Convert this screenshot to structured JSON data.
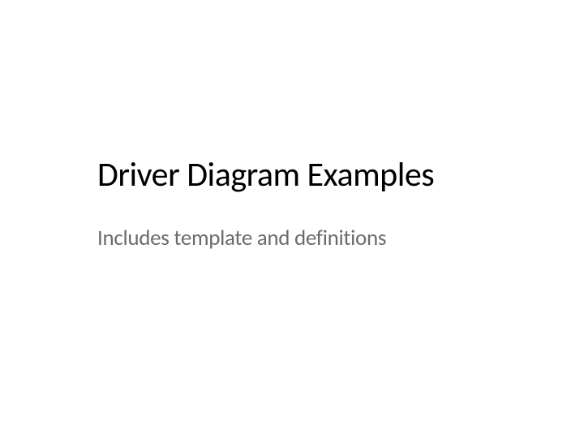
{
  "slide": {
    "title": "Driver Diagram Examples",
    "subtitle": "Includes template and definitions"
  }
}
